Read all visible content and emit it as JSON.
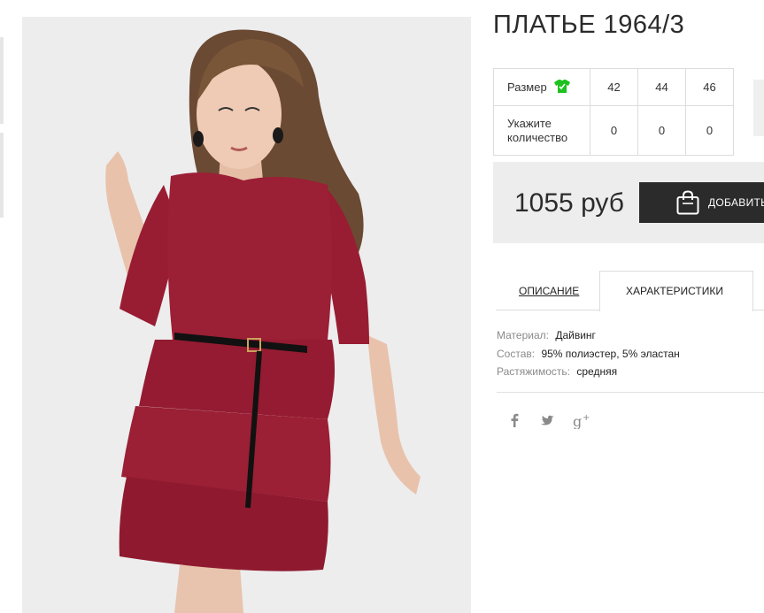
{
  "product": {
    "title": "ПЛАТЬЕ 1964/3",
    "price": "1055 руб",
    "add_to_cart_label": "ДОБАВИТЬ В КОРЗИНУ",
    "image_alt": "Woman wearing burgundy peplum dress with black belt"
  },
  "size_table": {
    "size_label": "Размер",
    "quantity_label_line1": "Укажите",
    "quantity_label_line2": "количество",
    "sizes": [
      "42",
      "44",
      "46"
    ],
    "quantities": [
      "0",
      "0",
      "0"
    ]
  },
  "tabs": {
    "description": "ОПИСАНИЕ",
    "characteristics": "ХАРАКТЕРИСТИКИ",
    "active": "characteristics"
  },
  "specs": [
    {
      "key": "Материал:",
      "value": "Дайвинг"
    },
    {
      "key": "Состав:",
      "value": "95% полиэстер, 5% эластан"
    },
    {
      "key": "Растяжимость:",
      "value": "средняя"
    }
  ],
  "social": [
    "facebook-icon",
    "twitter-icon",
    "google-plus-icon"
  ],
  "colors": {
    "accent_dark": "#2b2b2b",
    "size_icon_green": "#1ec11e",
    "dress_burgundy": "#9b1f35",
    "price_bar_bg": "#ededed"
  }
}
